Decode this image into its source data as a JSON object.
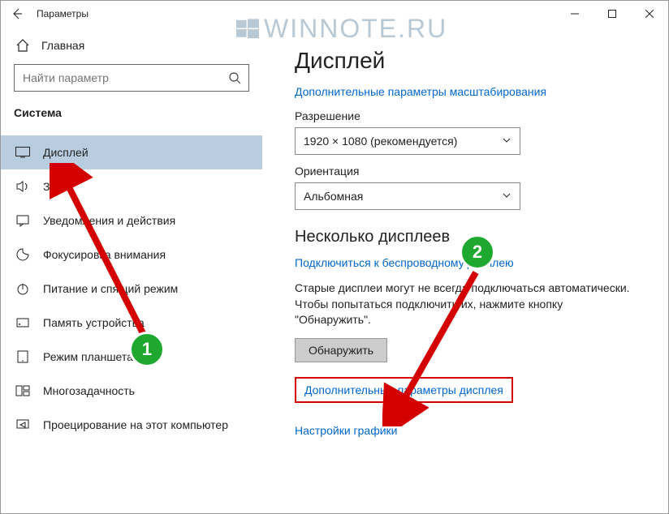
{
  "window": {
    "title": "Параметры"
  },
  "watermark": "WINNOTE.RU",
  "sidebar": {
    "home": "Главная",
    "search_placeholder": "Найти параметр",
    "group": "Система",
    "items": [
      {
        "label": "Дисплей"
      },
      {
        "label": "Звук"
      },
      {
        "label": "Уведомления и действия"
      },
      {
        "label": "Фокусировка внимания"
      },
      {
        "label": "Питание и спящий режим"
      },
      {
        "label": "Память устройства"
      },
      {
        "label": "Режим планшета"
      },
      {
        "label": "Многозадачность"
      },
      {
        "label": "Проецирование на этот компьютер"
      }
    ]
  },
  "content": {
    "title": "Дисплей",
    "scaling_link": "Дополнительные параметры масштабирования",
    "resolution_label": "Разрешение",
    "resolution_value": "1920 × 1080 (рекомендуется)",
    "orientation_label": "Ориентация",
    "orientation_value": "Альбомная",
    "multi_title": "Несколько дисплеев",
    "wireless_link": "Подключиться к беспроводному дисплею",
    "multi_text": "Старые дисплеи могут не всегда подключаться автоматически. Чтобы попытаться подключить их, нажмите кнопку \"Обнаружить\".",
    "detect_btn": "Обнаружить",
    "adv_display_link": "Дополнительные параметры дисплея",
    "graphics_link": "Настройки графики"
  },
  "annotations": {
    "n1": "1",
    "n2": "2"
  }
}
